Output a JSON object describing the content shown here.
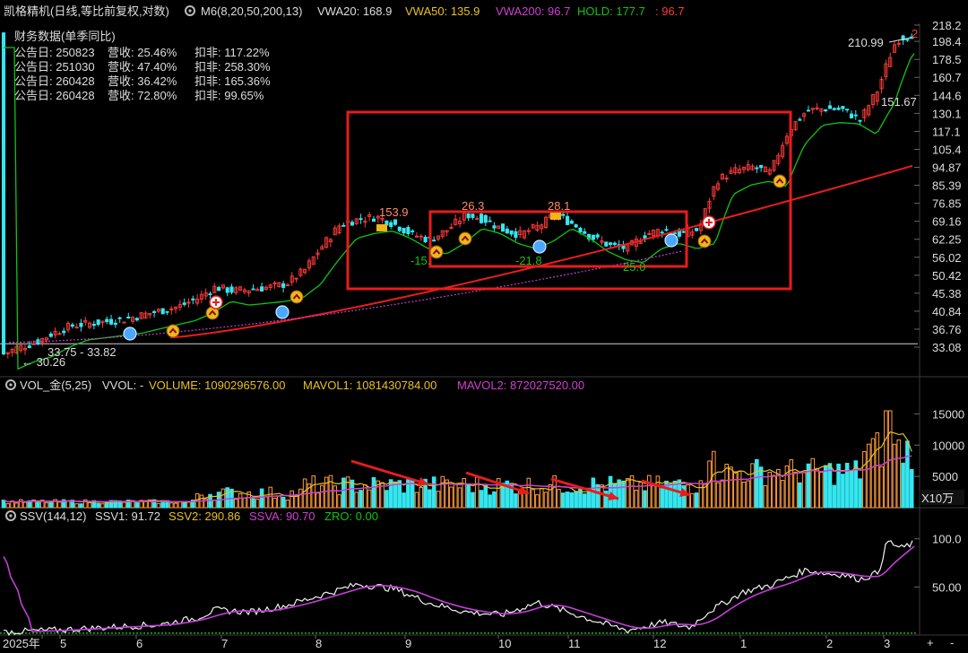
{
  "colors": {
    "up": "#ff3b3b",
    "down": "#35e6f0",
    "ma_green": "#11c411",
    "ma_red": "#e81e1e",
    "vol_ma1": "#e8c020",
    "vol_ma2": "#d040d0",
    "ssv_white": "#f2f2f2",
    "ssv_purple": "#c23fd6",
    "zero_green": "#1fd31f",
    "box_red": "#e81c1c",
    "grid": "#2a2a2a",
    "axis_text": "#dddddd"
  },
  "header": {
    "title": "凯格精机(日线,等比前复权,对数)",
    "indicator": "M6(8,20,50,200,13)",
    "vwa20": "VWA20: 168.9",
    "vwa50": "VWA50: 135.9",
    "vwa200": "VWA200: 96.7",
    "hold": "HOLD: 177.7",
    "hold_neg": ": 96.7"
  },
  "fin": {
    "title": "财务数据(单季同比)",
    "rows": [
      {
        "date": "公告日: 250823",
        "rev": "营收: 25.46%",
        "net": "扣非: 117.22%"
      },
      {
        "date": "公告日: 251030",
        "rev": "营收: 47.40%",
        "net": "扣非: 258.30%"
      },
      {
        "date": "公告日: 260428",
        "rev": "营收: 36.42%",
        "net": "扣非: 165.36%"
      },
      {
        "date": "公告日: 260428",
        "rev": "营收: 72.80%",
        "net": "扣非: 99.65%"
      }
    ]
  },
  "vol_header": {
    "name": "VOL_金(5,25)",
    "vvol": "VVOL: -",
    "volume": "VOLUME: 1090296576.00",
    "mavol1": "MAVOL1: 1081430784.00",
    "mavol2": "MAVOL2: 872027520.00"
  },
  "ssv_header": {
    "name": "SSV(144,12)",
    "ssv1": "SSV1: 91.72",
    "ssv2": "SSV2: 290.86",
    "ssva": "SSVA: 90.70",
    "zro": "ZRO: 0.00"
  },
  "price_labels": {
    "p153": "153.9",
    "p263": "26.3",
    "p281": "28.1",
    "n15": "-15.",
    "n218": "-21.8",
    "n250": "25.0",
    "high": "210.99",
    "high_arrow": "2",
    "low": "← 30.26",
    "range": "33.75 - 33.82",
    "p15167": "151.67"
  },
  "vol_unit": "X10万",
  "chart_data": [
    {
      "type": "candlestick",
      "scale": "log",
      "ylim": [
        30.26,
        218.2
      ],
      "yticks": [
        "218.2",
        "198.4",
        "178.5",
        "160.7",
        "144.6",
        "130.1",
        "117.1",
        "105.4",
        "94.87",
        "85.39",
        "76.85",
        "69.16",
        "62.25",
        "56.02",
        "50.42",
        "45.38",
        "40.84",
        "36.76",
        "33.08"
      ],
      "xticks": [
        "2025年",
        "5",
        "6",
        "7",
        "8",
        "9",
        "10",
        "11",
        "12",
        "1",
        "2",
        "3"
      ],
      "hline": 33.75,
      "notes": "approximate close path read from chart",
      "close_path": [
        [
          0,
          31.5
        ],
        [
          20,
          33
        ],
        [
          40,
          34
        ],
        [
          60,
          36
        ],
        [
          80,
          37.5
        ],
        [
          100,
          38
        ],
        [
          120,
          38.5
        ],
        [
          140,
          39
        ],
        [
          160,
          40
        ],
        [
          180,
          41
        ],
        [
          200,
          42
        ],
        [
          220,
          44
        ],
        [
          240,
          47
        ],
        [
          260,
          46
        ],
        [
          280,
          46.5
        ],
        [
          300,
          47
        ],
        [
          320,
          48
        ],
        [
          340,
          52
        ],
        [
          360,
          60
        ],
        [
          380,
          68
        ],
        [
          400,
          70
        ],
        [
          420,
          71
        ],
        [
          440,
          68
        ],
        [
          460,
          64
        ],
        [
          480,
          62
        ],
        [
          500,
          66
        ],
        [
          520,
          72
        ],
        [
          540,
          70
        ],
        [
          560,
          66
        ],
        [
          580,
          64
        ],
        [
          600,
          67
        ],
        [
          620,
          72
        ],
        [
          640,
          68
        ],
        [
          660,
          63
        ],
        [
          680,
          60
        ],
        [
          700,
          59
        ],
        [
          720,
          64
        ],
        [
          740,
          66
        ],
        [
          760,
          64
        ],
        [
          780,
          66
        ],
        [
          800,
          88
        ],
        [
          820,
          93
        ],
        [
          840,
          95
        ],
        [
          860,
          92
        ],
        [
          880,
          118
        ],
        [
          900,
          132
        ],
        [
          920,
          134
        ],
        [
          940,
          133
        ],
        [
          960,
          125
        ],
        [
          980,
          150
        ],
        [
          1000,
          200
        ],
        [
          1020,
          208
        ]
      ]
    },
    {
      "type": "bar",
      "name": "volume",
      "yticks": [
        "15000",
        "10000",
        "5000"
      ],
      "ylim": [
        0,
        17500
      ],
      "notes": "approximate volume in X10万 units"
    },
    {
      "type": "line",
      "name": "SSV",
      "yticks": [
        "100.0",
        "50.00"
      ],
      "ylim": [
        0,
        110
      ]
    }
  ],
  "bottom_controls": {
    "plus": "+",
    "minus": "-"
  }
}
